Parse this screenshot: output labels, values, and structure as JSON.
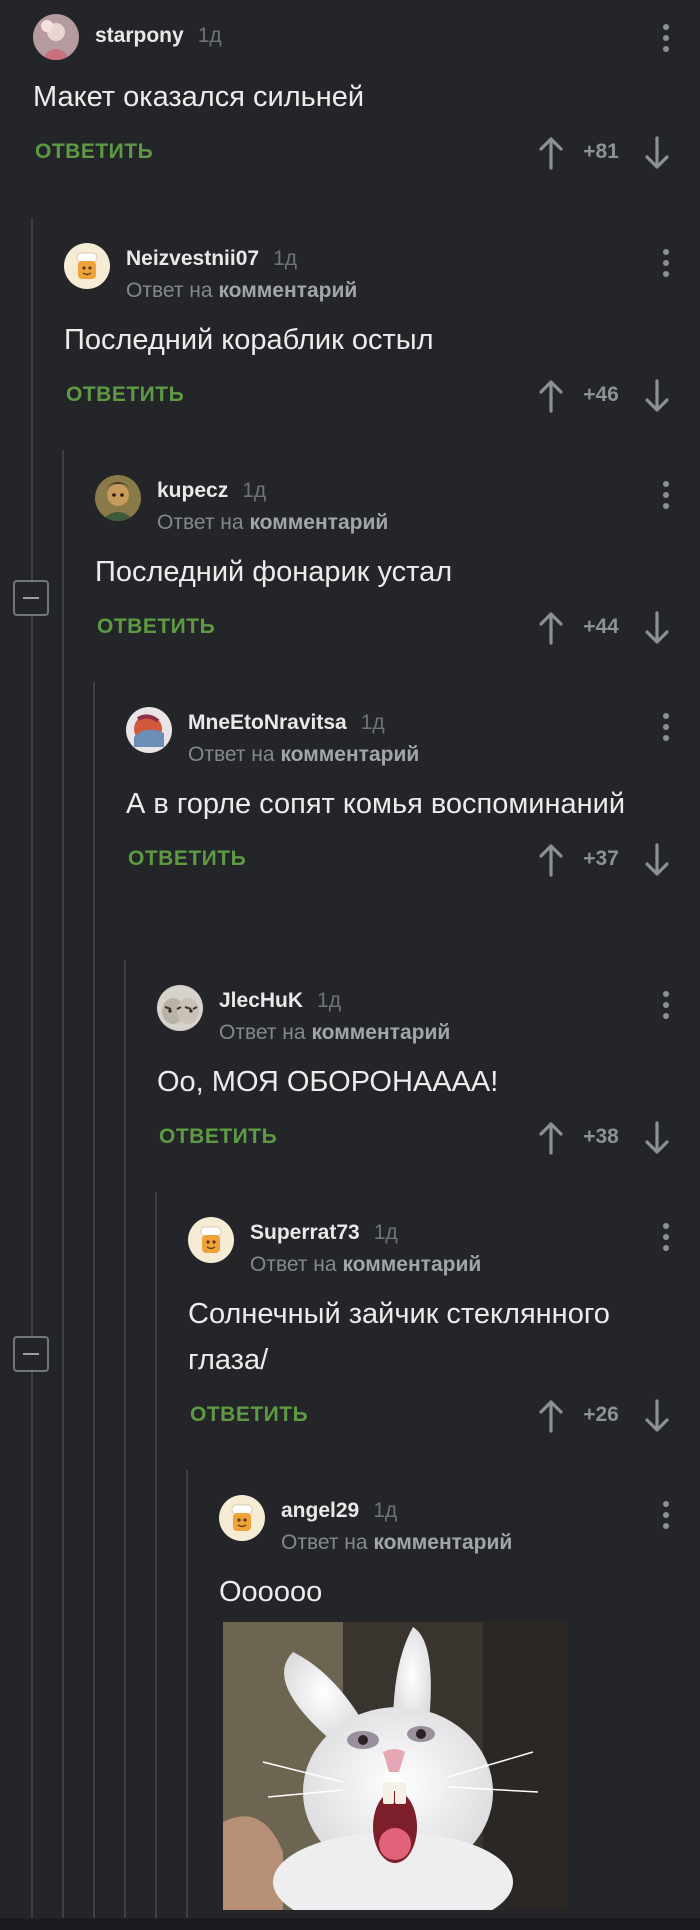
{
  "comments": [
    {
      "author": "starpony",
      "time": "1д",
      "text": "Макет оказался сильней",
      "score": "+81",
      "reply_label": "ОТВЕТИТЬ"
    },
    {
      "author": "Neizvestnii07",
      "time": "1д",
      "reply_to": "Ответ на",
      "reply_to_link": "комментарий",
      "text": "Последний кораблик остыл",
      "score": "+46",
      "reply_label": "ОТВЕТИТЬ"
    },
    {
      "author": "kupecz",
      "time": "1д",
      "reply_to": "Ответ на",
      "reply_to_link": "комментарий",
      "text": "Последний фонарик устал",
      "score": "+44",
      "reply_label": "ОТВЕТИТЬ"
    },
    {
      "author": "MneEtoNravitsa",
      "time": "1д",
      "reply_to": "Ответ на",
      "reply_to_link": "комментарий",
      "text": "А в горле сопят комья воспоминаний",
      "score": "+37",
      "reply_label": "ОТВЕТИТЬ"
    },
    {
      "author": "JlecHuK",
      "time": "1д",
      "reply_to": "Ответ на",
      "reply_to_link": "комментарий",
      "text": "Оо, МОЯ ОБОРОНАААА!",
      "score": "+38",
      "reply_label": "ОТВЕТИТЬ"
    },
    {
      "author": "Superrat73",
      "time": "1д",
      "reply_to": "Ответ на",
      "reply_to_link": "комментарий",
      "text": "Солнечный зайчик стеклянного глаза/",
      "score": "+26",
      "reply_label": "ОТВЕТИТЬ"
    },
    {
      "author": "angel29",
      "time": "1д",
      "reply_to": "Ответ на",
      "reply_to_link": "комментарий",
      "text": "Оооооо"
    }
  ],
  "icons": {
    "vote_up": "arrow-up-icon",
    "vote_down": "arrow-down-icon",
    "menu": "kebab-menu-icon",
    "collapse": "minus-icon"
  },
  "colors": {
    "background": "#232528",
    "reply_action": "#5d9a43",
    "score": "#8d9196",
    "thread_line": "#3d4045"
  }
}
